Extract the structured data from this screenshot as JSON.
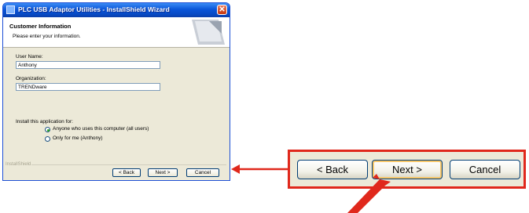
{
  "window": {
    "title": "PLC USB Adaptor Utilities - InstallShield Wizard",
    "close_glyph": "✕"
  },
  "banner": {
    "title": "Customer Information",
    "subtitle": "Please enter your information."
  },
  "form": {
    "user_name_label": "User Name:",
    "user_name_value": "Anthony",
    "organization_label": "Organization:",
    "organization_value": "TRENDware",
    "install_for_label": "Install this application for:",
    "options": [
      {
        "label": "Anyone who uses this computer (all users)",
        "selected": true
      },
      {
        "label": "Only for me (Anthony)",
        "selected": false
      }
    ]
  },
  "footer": {
    "brand": "InstallShield",
    "back_label": "< Back",
    "next_label": "Next >",
    "cancel_label": "Cancel"
  },
  "callout": {
    "back_label": "< Back",
    "next_label": "Next >",
    "cancel_label": "Cancel",
    "highlight_color": "#e0281c"
  },
  "icons": [
    "installer-icon",
    "close-icon",
    "radio-icon",
    "pointer-arrow-icon"
  ]
}
